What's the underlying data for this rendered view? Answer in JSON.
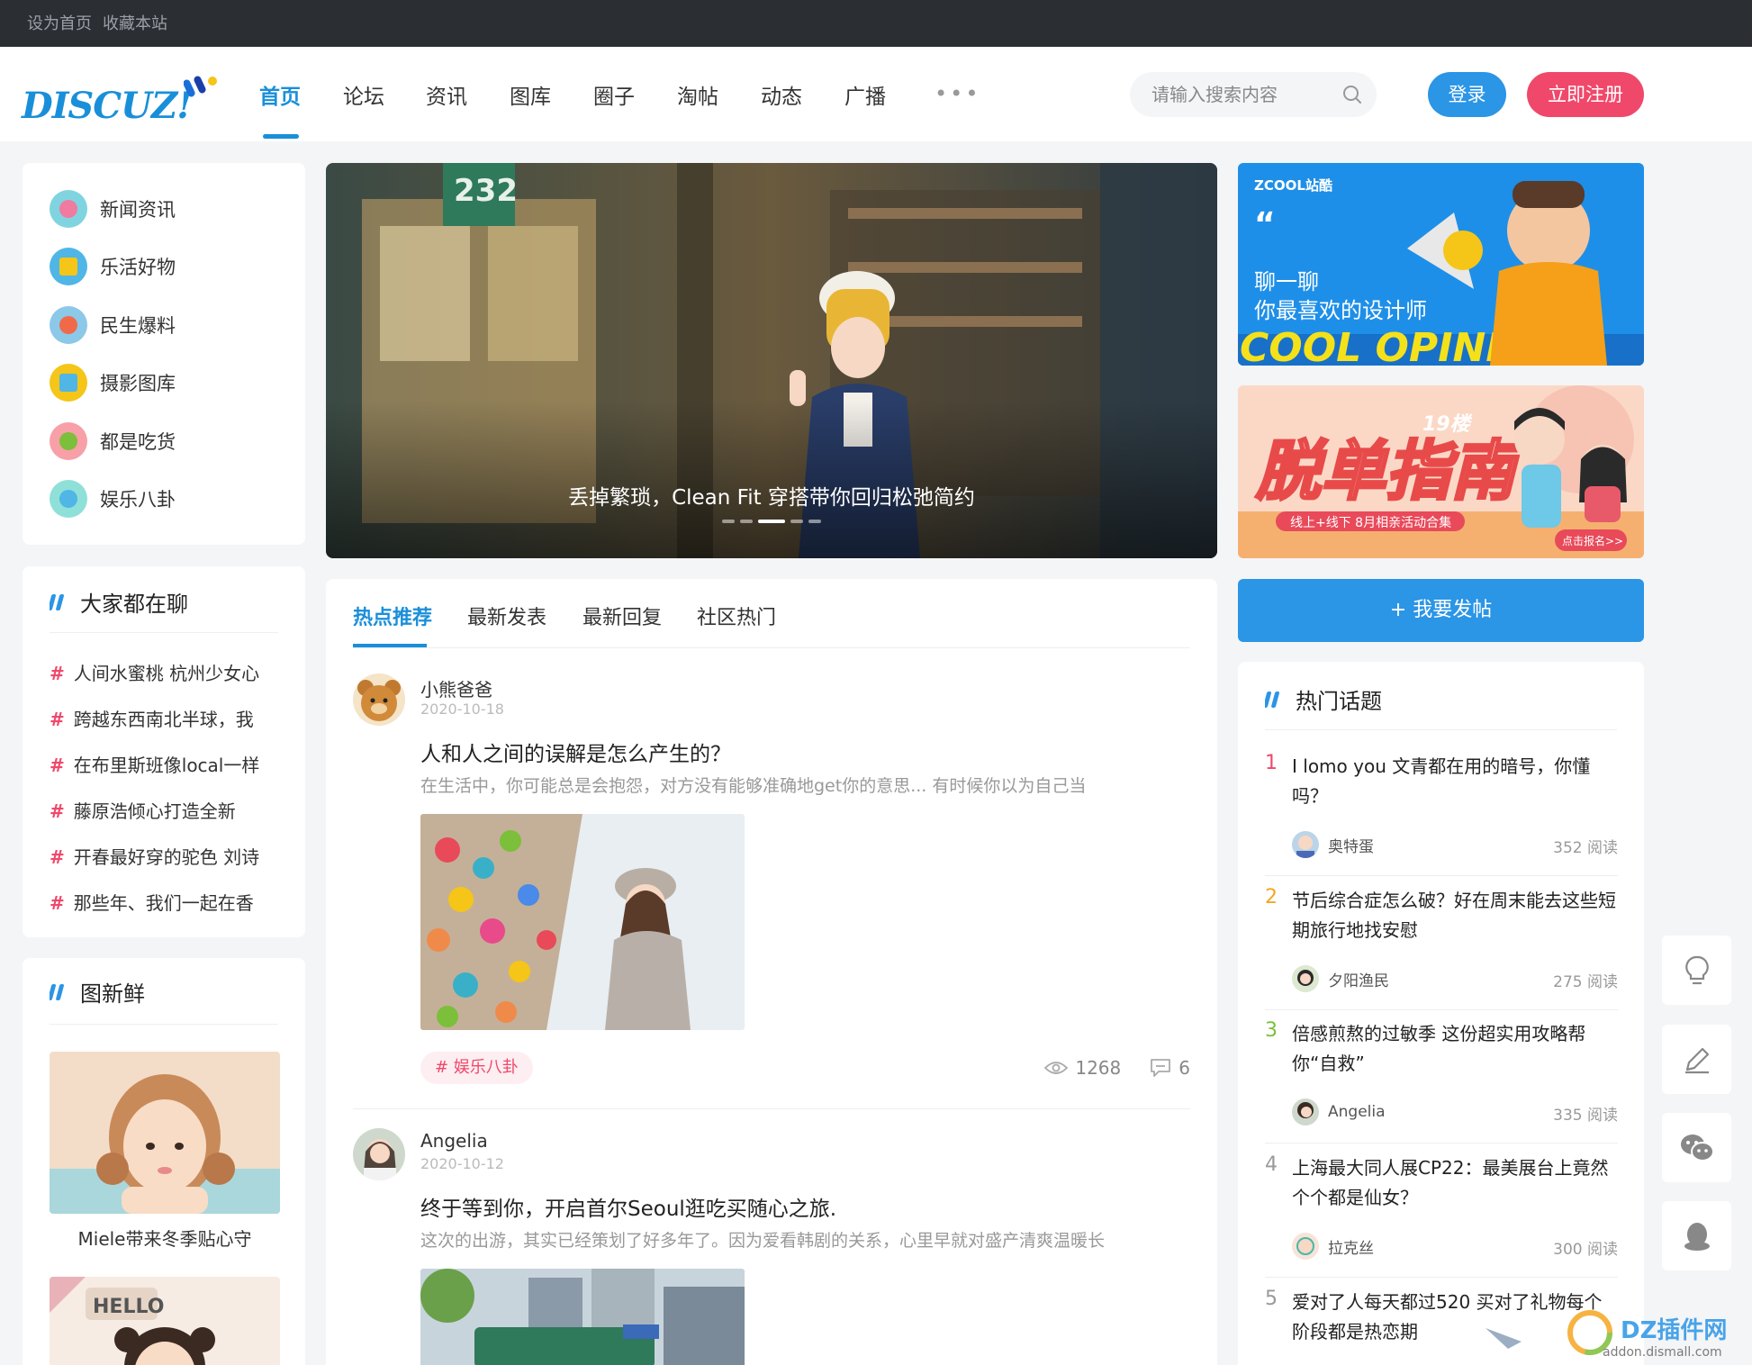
{
  "topbar": {
    "set_home": "设为首页",
    "bookmark": "收藏本站"
  },
  "header": {
    "logo_text": "DISCUZ!",
    "nav": [
      "首页",
      "论坛",
      "资讯",
      "图库",
      "圈子",
      "淘帖",
      "动态",
      "广播"
    ],
    "nav_more": "•••",
    "search_placeholder": "请输入搜索内容",
    "login": "登录",
    "register": "立即注册"
  },
  "categories": [
    "新闻资讯",
    "乐活好物",
    "民生爆料",
    "摄影图库",
    "都是吃货",
    "娱乐八卦"
  ],
  "chatting": {
    "title": "大家都在聊",
    "items": [
      "人间水蜜桃 杭州少女心",
      "跨越东西南北半球，我",
      "在布里斯班像local一样",
      "藤原浩倾心打造全新",
      "开春最好穿的驼色 刘诗",
      "那些年、我们一起在香"
    ]
  },
  "fresh_pics": {
    "title": "图新鲜",
    "items": [
      {
        "caption": "Miele带来冬季贴心守"
      },
      {
        "caption": ""
      }
    ],
    "hello_text": "HELLO"
  },
  "slider": {
    "caption": "丢掉繁琐，Clean Fit 穿搭带你回归松弛简约",
    "sign_number": "232"
  },
  "ads": {
    "ad1_brand": "ZCOOL站酷",
    "ad1_line1": "聊一聊",
    "ad1_line2": "你最喜欢的设计师",
    "ad1_big": "COOL OPINIONS",
    "ad2_big": "脱单指南",
    "ad2_brand": "19楼",
    "ad2_sub": "线上+线下 8月相亲活动合集",
    "ad2_btn": "点击报名>>"
  },
  "feed": {
    "tabs": [
      "热点推荐",
      "最新发表",
      "最新回复",
      "社区热门"
    ],
    "posts": [
      {
        "author": "小熊爸爸",
        "date": "2020-10-18",
        "title": "人和人之间的误解是怎么产生的？",
        "summary": "在生活中，你可能总是会抱怨，对方没有能够准确地get你的意思... 有时候你以为自己当",
        "tag": "# 娱乐八卦",
        "views": "1268",
        "comments": "6"
      },
      {
        "author": "Angelia",
        "date": "2020-10-12",
        "title": "终于等到你，开启首尔Seoul逛吃买随心之旅.",
        "summary": "这次的出游，其实已经策划了好多年了。因为爱看韩剧的关系，心里早就对盛产清爽温暖长"
      }
    ]
  },
  "post_button": "+ 我要发帖",
  "hot_topics": {
    "title": "热门话题",
    "items": [
      {
        "num": "1",
        "title": "I lomo you 文青都在用的暗号，你懂吗？",
        "user": "奥特蛋",
        "reads": "352 阅读"
      },
      {
        "num": "2",
        "title": "节后综合症怎么破？好在周末能去这些短期旅行地找安慰",
        "user": "夕阳渔民",
        "reads": "275 阅读"
      },
      {
        "num": "3",
        "title": "倍感煎熬的过敏季 这份超实用攻略帮你“自救”",
        "user": "Angelia",
        "reads": "335 阅读"
      },
      {
        "num": "4",
        "title": "上海最大同人展CP22：最美展台上竟然个个都是仙女？",
        "user": "拉克丝",
        "reads": "300 阅读"
      },
      {
        "num": "5",
        "title": "爱对了人每天都过520 买对了礼物每个阶段都是热恋期",
        "user": "",
        "reads": ""
      }
    ],
    "num_colors": [
      "#f0486a",
      "#f5a623",
      "#7bbf3a",
      "#999999",
      "#999999"
    ]
  },
  "watermark": {
    "text": "DZ插件网",
    "sub": "addon.dismall.com"
  },
  "colors": {
    "accent": "#1a8fd9",
    "pink": "#f0486a",
    "topbar": "#2b2e33"
  }
}
